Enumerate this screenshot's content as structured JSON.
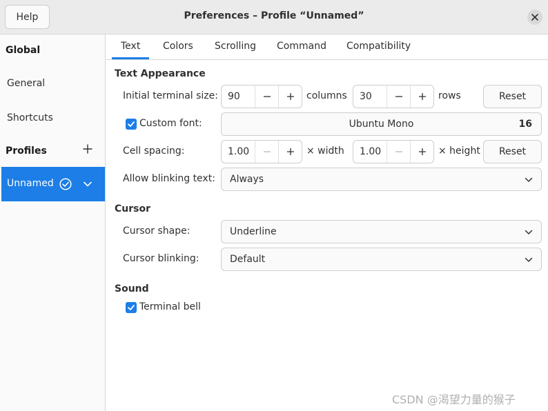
{
  "titlebar": {
    "help_label": "Help",
    "title": "Preferences – Profile “Unnamed”"
  },
  "sidebar": {
    "global_heading": "Global",
    "items": [
      {
        "label": "General"
      },
      {
        "label": "Shortcuts"
      }
    ],
    "profiles_heading": "Profiles",
    "profiles": [
      {
        "label": "Unnamed",
        "selected": true,
        "is_default": true
      }
    ]
  },
  "tabs": [
    {
      "label": "Text",
      "active": true
    },
    {
      "label": "Colors",
      "active": false
    },
    {
      "label": "Scrolling",
      "active": false
    },
    {
      "label": "Command",
      "active": false
    },
    {
      "label": "Compatibility",
      "active": false
    }
  ],
  "text_appearance": {
    "heading": "Text Appearance",
    "initial_size": {
      "label": "Initial terminal size:",
      "columns_value": "90",
      "columns_unit": "columns",
      "rows_value": "30",
      "rows_unit": "rows",
      "reset_label": "Reset"
    },
    "custom_font": {
      "label": "Custom font:",
      "checked": true,
      "font_name": "Ubuntu Mono",
      "font_size": "16"
    },
    "cell_spacing": {
      "label": "Cell spacing:",
      "width_value": "1.00",
      "width_unit": "× width",
      "height_value": "1.00",
      "height_unit": "× height",
      "reset_label": "Reset"
    },
    "blinking_text": {
      "label": "Allow blinking text:",
      "value": "Always"
    }
  },
  "cursor": {
    "heading": "Cursor",
    "shape": {
      "label": "Cursor shape:",
      "value": "Underline"
    },
    "blinking": {
      "label": "Cursor blinking:",
      "value": "Default"
    }
  },
  "sound": {
    "heading": "Sound",
    "terminal_bell": {
      "label": "Terminal bell",
      "checked": true
    }
  },
  "watermark": "CSDN @渴望力量的猴子",
  "colors": {
    "accent": "#1c7ee6",
    "titlebar_bg": "#ebebeb",
    "sidebar_bg": "#fafafa"
  }
}
